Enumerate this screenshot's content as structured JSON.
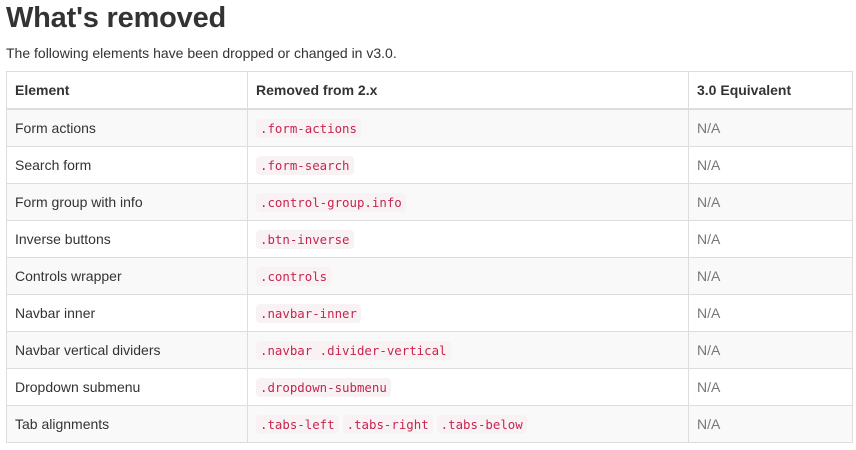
{
  "heading": "What's removed",
  "intro": "The following elements have been dropped or changed in v3.0.",
  "table": {
    "headers": [
      "Element",
      "Removed from 2.x",
      "3.0 Equivalent"
    ],
    "rows": [
      {
        "element": "Form actions",
        "removed": [
          ".form-actions"
        ],
        "equivalent": "N/A"
      },
      {
        "element": "Search form",
        "removed": [
          ".form-search"
        ],
        "equivalent": "N/A"
      },
      {
        "element": "Form group with info",
        "removed": [
          ".control-group.info"
        ],
        "equivalent": "N/A"
      },
      {
        "element": "Inverse buttons",
        "removed": [
          ".btn-inverse"
        ],
        "equivalent": "N/A"
      },
      {
        "element": "Controls wrapper",
        "removed": [
          ".controls"
        ],
        "equivalent": "N/A"
      },
      {
        "element": "Navbar inner",
        "removed": [
          ".navbar-inner"
        ],
        "equivalent": "N/A"
      },
      {
        "element": "Navbar vertical dividers",
        "removed": [
          ".navbar .divider-vertical"
        ],
        "equivalent": "N/A"
      },
      {
        "element": "Dropdown submenu",
        "removed": [
          ".dropdown-submenu"
        ],
        "equivalent": "N/A"
      },
      {
        "element": "Tab alignments",
        "removed": [
          ".tabs-left",
          ".tabs-right",
          ".tabs-below"
        ],
        "equivalent": "N/A"
      }
    ]
  },
  "colors": {
    "text": "#333333",
    "code_text": "#c7254e",
    "code_bg": "#f9f2f4",
    "stripe": "#f9f9f9",
    "border": "#dddddd",
    "muted": "#777777"
  }
}
